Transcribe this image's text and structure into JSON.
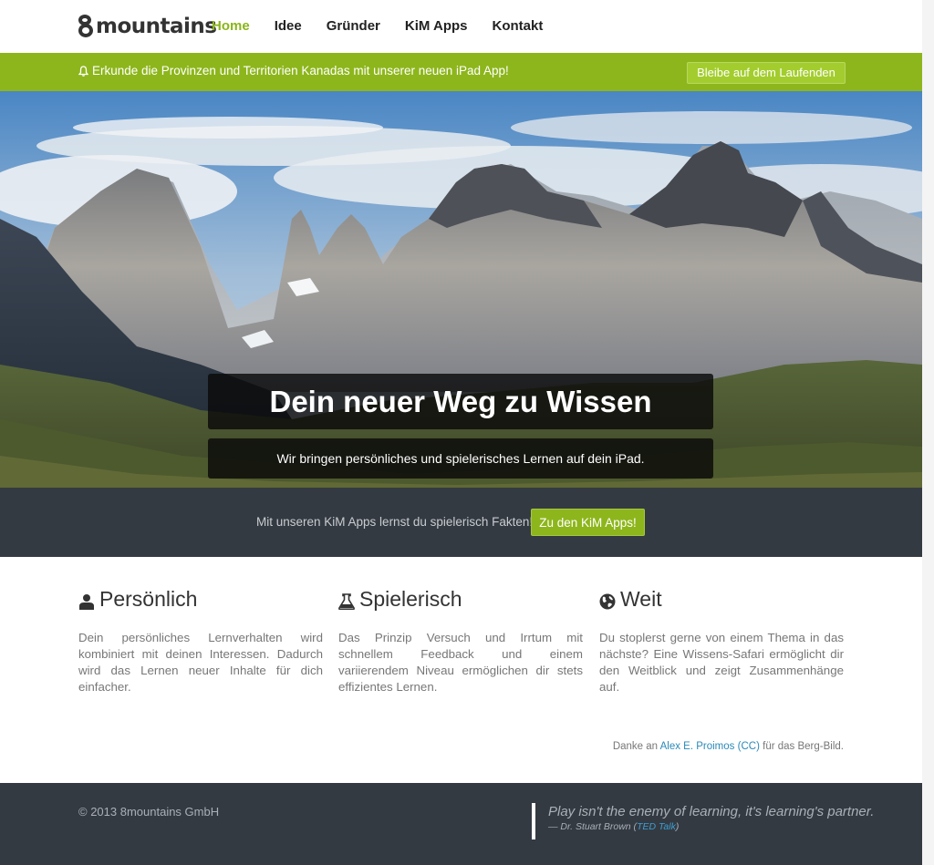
{
  "brand": {
    "logo_text": "mountains"
  },
  "nav": {
    "items": [
      {
        "label": "Home",
        "active": true
      },
      {
        "label": "Idee"
      },
      {
        "label": "Gründer"
      },
      {
        "label": "KiM Apps"
      },
      {
        "label": "Kontakt"
      }
    ]
  },
  "announcement": {
    "text": "Erkunde die Provinzen und Territorien Kanadas mit unserer neuen iPad App!",
    "button_label": "Bleibe auf dem Laufenden"
  },
  "hero": {
    "title": "Dein neuer Weg zu Wissen",
    "subtitle": "Wir bringen persönliches und spielerisches Lernen auf dein iPad."
  },
  "cta": {
    "text": "Mit unseren KiM Apps lernst du spielerisch Fakten!",
    "button_label": "Zu den KiM Apps!"
  },
  "features": [
    {
      "icon": "user-icon",
      "title": "Persönlich",
      "text": "Dein persönliches Lernverhalten wird kombiniert mit deinen Interessen. Dadurch wird das Lernen neuer Inhalte für dich einfacher."
    },
    {
      "icon": "flask-icon",
      "title": "Spielerisch",
      "text": "Das Prinzip Versuch und Irrtum mit schnellem Feedback und einem variierendem Niveau ermöglichen dir stets effizientes Lernen."
    },
    {
      "icon": "globe-icon",
      "title": "Weit",
      "text": "Du stoplerst gerne von einem Thema in das nächste? Eine Wissens-Safari ermöglicht dir den Weitblick und zeigt Zusammenhänge auf."
    }
  ],
  "credit": {
    "prefix": "Danke an",
    "author": "Alex E. Proimos",
    "license_open": "(",
    "license": "CC",
    "license_close": ")",
    "suffix": "für das Berg-Bild."
  },
  "footer": {
    "copyright": "© 2013 8mountains GmbH",
    "quote": "Play isn't the enemy of learning, it's learning's partner.",
    "cite_prefix": "— Dr. Stuart Brown (",
    "cite_link": "TED Talk",
    "cite_suffix": ")"
  },
  "colors": {
    "accent": "#8db61c",
    "dark": "#343a42",
    "link": "#2a8ab8"
  }
}
